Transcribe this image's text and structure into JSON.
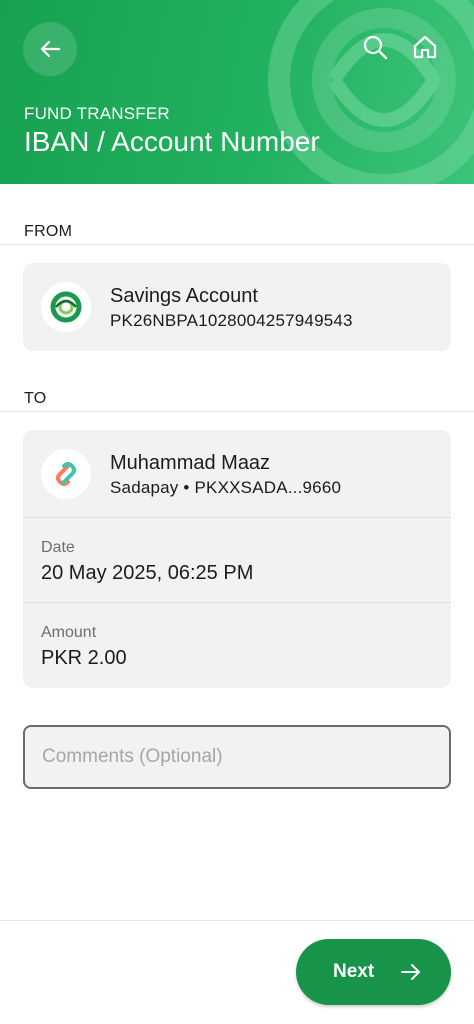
{
  "header": {
    "subtitle": "FUND TRANSFER",
    "title": "IBAN / Account Number",
    "background": "#1aa657",
    "back_icon": "arrow-left-icon",
    "search_icon": "search-icon",
    "home_icon": "home-icon"
  },
  "from": {
    "label": "FROM",
    "account_name": "Savings Account",
    "account_number": "PK26NBPA1028004257949543",
    "logo_icon": "bank-logo-icon"
  },
  "to": {
    "label": "TO",
    "recipient_name": "Muhammad Maaz",
    "recipient_details": "Sadapay • PKXXSADA...9660",
    "logo_icon": "sadapay-logo-icon",
    "date_label": "Date",
    "date_value": "20 May 2025, 06:25 PM",
    "amount_label": "Amount",
    "amount_value": "PKR 2.00"
  },
  "comments": {
    "placeholder": "Comments (Optional)",
    "value": ""
  },
  "footer": {
    "next_label": "Next",
    "accent": "#17944a"
  }
}
